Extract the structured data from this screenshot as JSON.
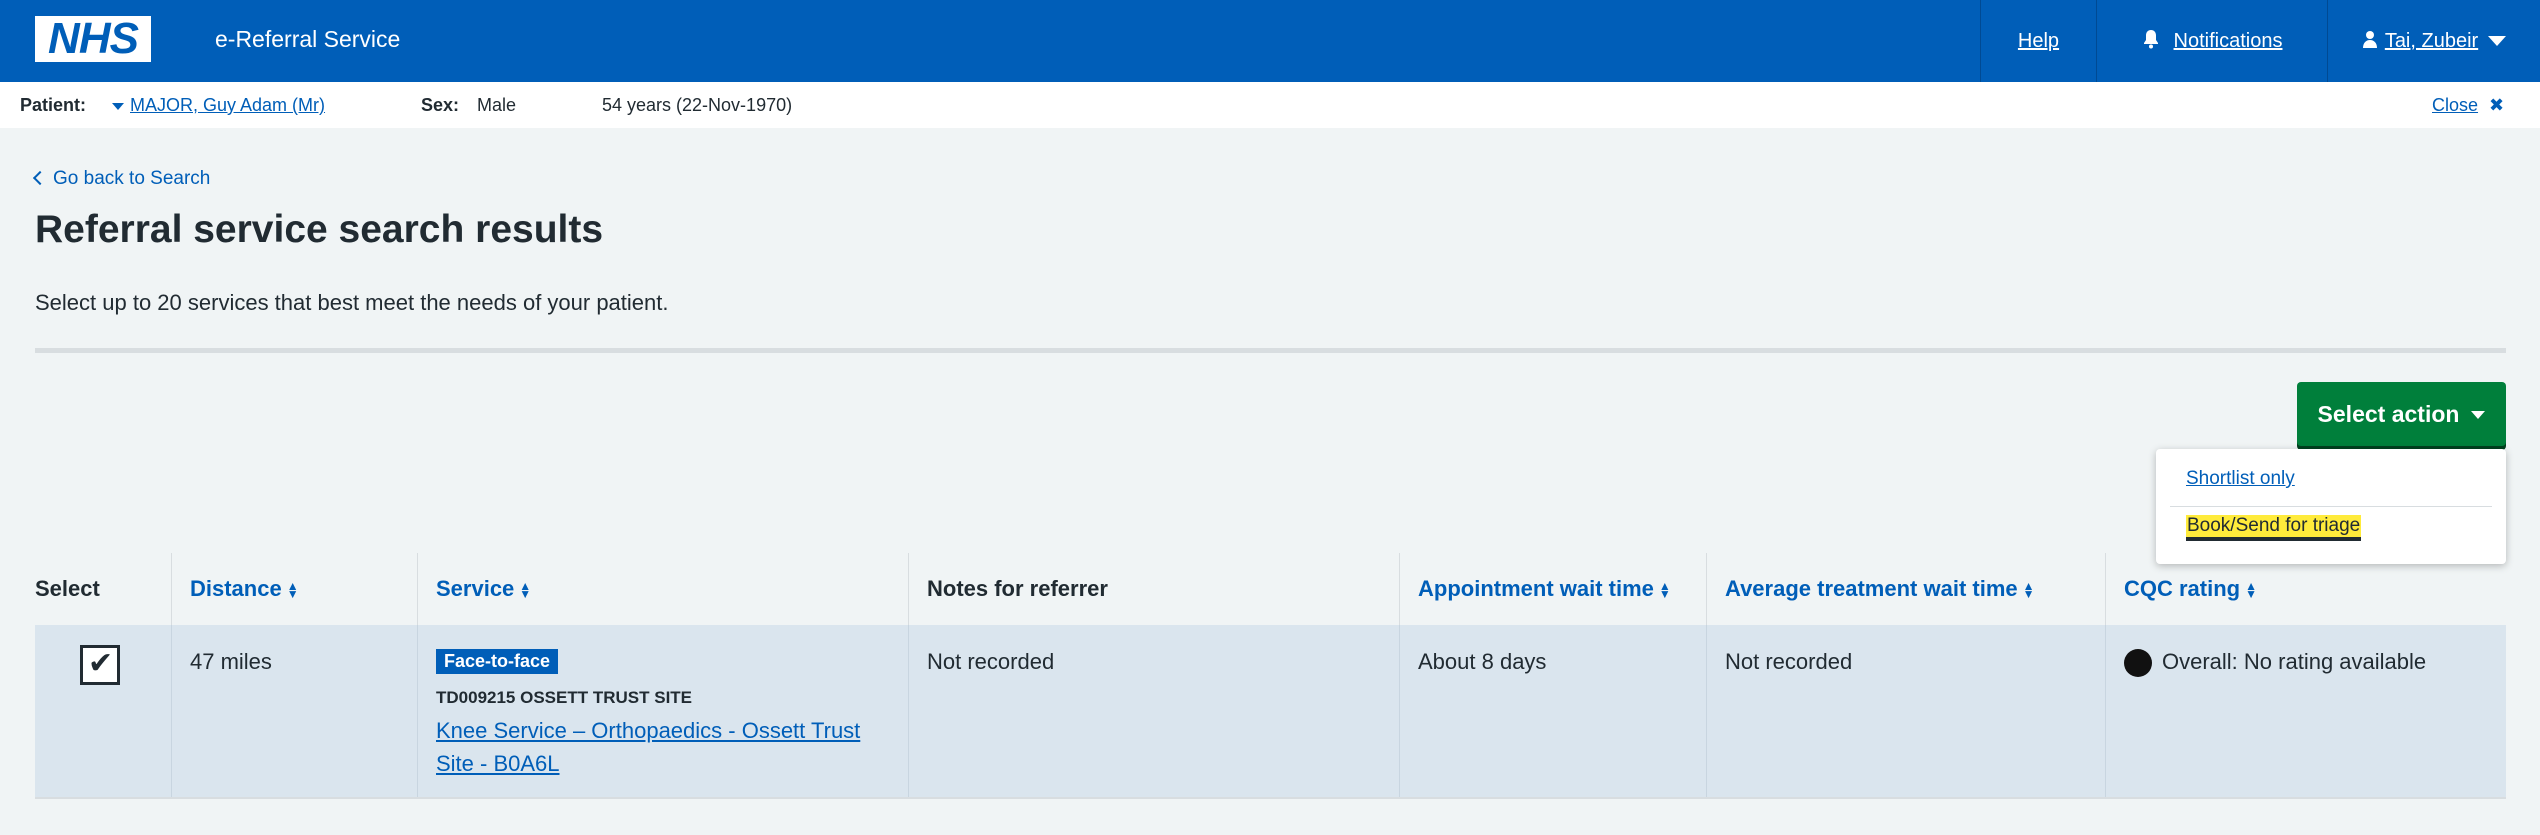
{
  "header": {
    "logo_text": "NHS",
    "service_name": "e-Referral Service",
    "help": "Help",
    "notifications": "Notifications",
    "user": "Tai, Zubeir"
  },
  "patient": {
    "patient_label": "Patient:",
    "name": "MAJOR, Guy Adam (Mr)",
    "sex_label": "Sex:",
    "sex": "Male",
    "age_dob": "54 years (22-Nov-1970)",
    "close": "Close"
  },
  "main": {
    "back_link": "Go back to Search",
    "title": "Referral service search results",
    "intro": "Select up to 20 services that best meet the needs of your patient.",
    "action_button": "Select action",
    "dropdown": [
      "Shortlist only",
      "Book/Send for triage"
    ]
  },
  "table": {
    "headers": [
      "Select",
      "Distance",
      "Service",
      "Notes for referrer",
      "Appointment wait time",
      "Average treatment wait time",
      "CQC rating"
    ],
    "rows": [
      {
        "selected": true,
        "distance": "47 miles",
        "badge": "Face-to-face",
        "site_code": "TD009215 OSSETT TRUST SITE",
        "service": "Knee Service – Orthopaedics - Ossett Trust Site - B0A6L",
        "notes": "Not recorded",
        "appointment_wait": "About 8 days",
        "treatment_wait": "Not recorded",
        "cqc": "Overall: No rating available"
      }
    ]
  },
  "colors": {
    "nhs_blue": "#005eb8",
    "green": "#007f3b",
    "highlight": "#ffeb3b"
  }
}
